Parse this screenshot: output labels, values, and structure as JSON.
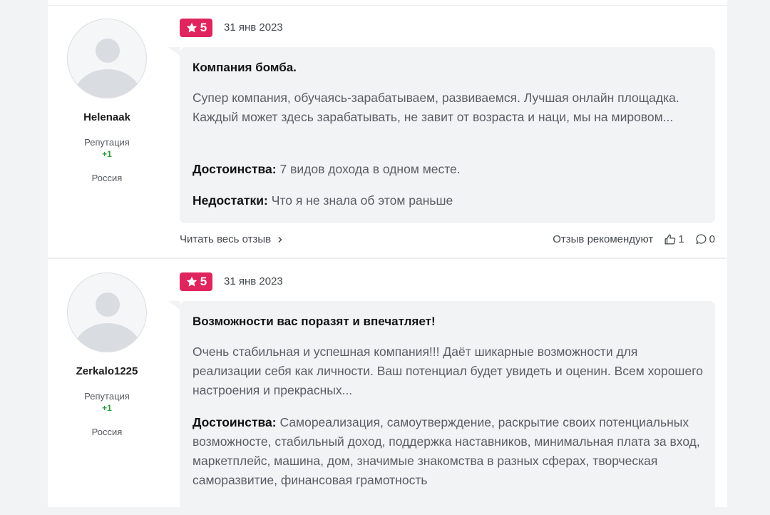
{
  "reviews": [
    {
      "username": "Helenaak",
      "reputation_label": "Репутация",
      "reputation_value": "+1",
      "country": "Россия",
      "rating": "5",
      "date": "31 янв 2023",
      "title": "Компания бомба.",
      "text": "Супер компания, обучаясь-зарабатываем, развиваемся. Лучшая онлайн площадка. Каждый может здесь зарабатывать, не завит от возраста и наци, мы на мировом...",
      "pros_label": "Достоинства:",
      "pros": " 7 видов дохода в одном месте.",
      "cons_label": "Недостатки:",
      "cons": " Что я не знала об этом раньше",
      "read_more": "Читать весь отзыв",
      "recommend_label": "Отзыв рекомендуют",
      "likes": "1",
      "comments": "0"
    },
    {
      "username": "Zerkalo1225",
      "reputation_label": "Репутация",
      "reputation_value": "+1",
      "country": "Россия",
      "rating": "5",
      "date": "31 янв 2023",
      "title": "Возможности вас поразят и впечатляет!",
      "text": "Очень стабильная и успешная компания!!! Даёт шикарные возможности для реализации себя как личности. Ваш потенциал будет увидеть и оценин. Всем хорошего настроения и прекрасных...",
      "pros_label": "Достоинства:",
      "pros": " Самореализация, самоутверждение, раскрытие своих потенциальных возможносте, стабильный доход, поддержка наставников, минимальная плата за вход, маркетплейс, машина, дом, значимые знакомства в разных сферах, творческая саморазвитие, финансовая грамотность"
    }
  ],
  "colors": {
    "accent": "#e0245e",
    "reputation": "#2e9b3c",
    "bubble": "#f2f3f5"
  }
}
